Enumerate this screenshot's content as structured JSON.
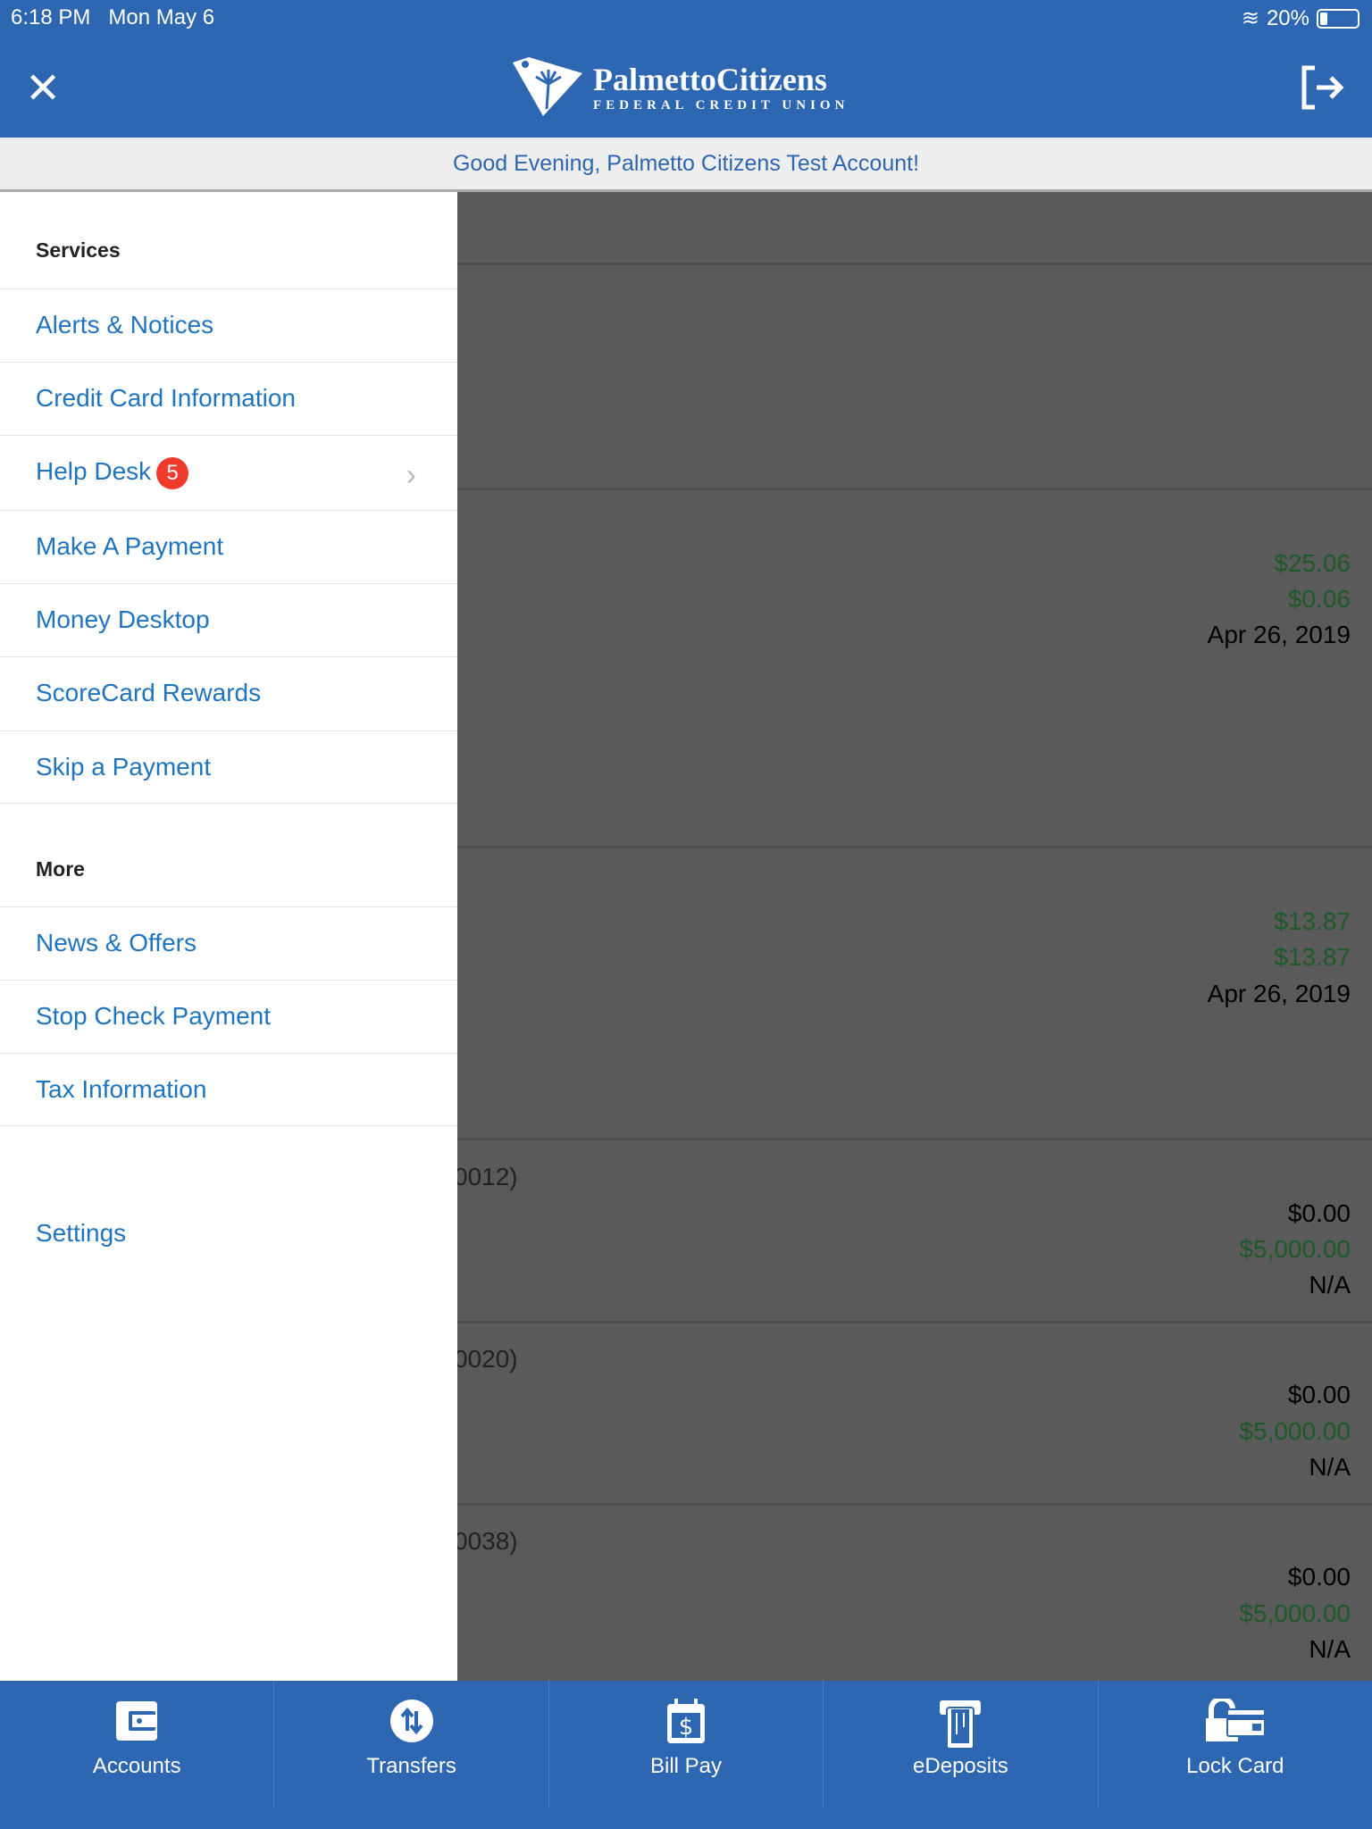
{
  "status_bar": {
    "time": "6:18 PM",
    "date": "Mon May 6",
    "battery": "20%",
    "battery_level": 0.2
  },
  "header": {
    "logo_name": "PalmettoCitizens",
    "logo_sub": "FEDERAL CREDIT UNION",
    "close_icon": "close-icon",
    "logout_icon": "logout-icon"
  },
  "greeting": "Good Evening, Palmetto Citizens Test Account!",
  "drawer": {
    "services_title": "Services",
    "services": [
      {
        "label": "Alerts & Notices"
      },
      {
        "label": "Credit Card Information"
      },
      {
        "label": "Help Desk",
        "badge": "5"
      },
      {
        "label": "Make A Payment"
      },
      {
        "label": "Money Desktop"
      },
      {
        "label": "ScoreCard Rewards"
      },
      {
        "label": "Skip a Payment"
      }
    ],
    "more_title": "More",
    "more": [
      {
        "label": "News & Offers"
      },
      {
        "label": "Stop Check Payment"
      },
      {
        "label": "Tax Information"
      }
    ],
    "settings": "Settings"
  },
  "accounts": [
    {
      "v1": "$25.06",
      "v2": "$0.06",
      "v3": "Apr 26, 2019"
    },
    {
      "v1": "$13.87",
      "v2": "$13.87",
      "v3": "Apr 26, 2019"
    },
    {
      "partial": "0012)",
      "v1": "$0.00",
      "v2": "$5,000.00",
      "v3": "N/A"
    },
    {
      "partial": "0020)",
      "v1": "$0.00",
      "v2": "$5,000.00",
      "v3": "N/A"
    },
    {
      "partial": "0038)",
      "v1": "$0.00",
      "v2": "$5,000.00",
      "v3": "N/A"
    }
  ],
  "tabs": [
    {
      "label": "Accounts",
      "icon": "wallet-icon"
    },
    {
      "label": "Transfers",
      "icon": "transfer-icon"
    },
    {
      "label": "Bill Pay",
      "icon": "bill-calendar-icon"
    },
    {
      "label": "eDeposits",
      "icon": "check-deposit-icon"
    },
    {
      "label": "Lock Card",
      "icon": "lock-card-icon"
    }
  ],
  "colors": {
    "brand": "#2d66b1",
    "link": "#1f74c0",
    "badge": "#f03a2c",
    "positive": "#1c5a2a"
  }
}
